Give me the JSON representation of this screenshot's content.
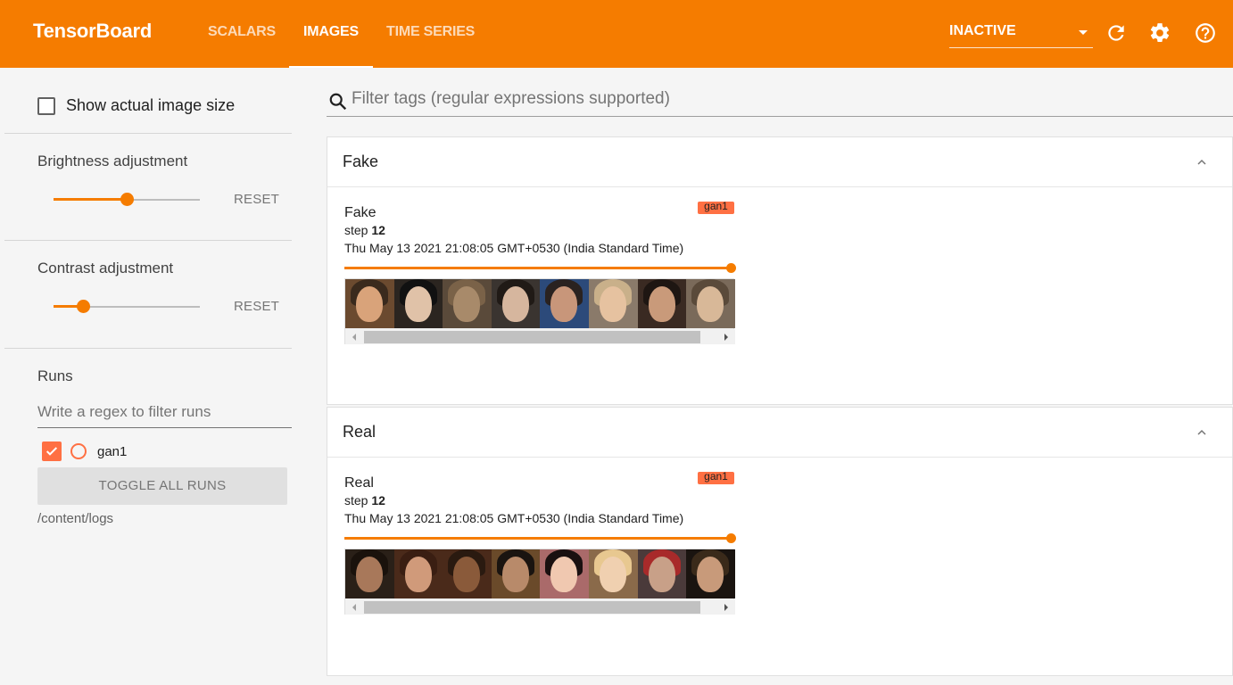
{
  "app": {
    "brand": "TensorBoard",
    "tabs": [
      {
        "label": "SCALARS",
        "active": false
      },
      {
        "label": "IMAGES",
        "active": true
      },
      {
        "label": "TIME SERIES",
        "active": false
      }
    ],
    "reload_status": "INACTIVE",
    "accent_color": "#f57c00",
    "run_color": "#ff7043"
  },
  "sidebar": {
    "show_actual_size_label": "Show actual image size",
    "show_actual_size_checked": false,
    "brightness": {
      "label": "Brightness adjustment",
      "reset_label": "RESET",
      "value_fraction": 0.5
    },
    "contrast": {
      "label": "Contrast adjustment",
      "reset_label": "RESET",
      "value_fraction": 0.2
    },
    "runs": {
      "title": "Runs",
      "filter_placeholder": "Write a regex to filter runs",
      "items": [
        {
          "name": "gan1",
          "checked": true
        }
      ],
      "toggle_all_label": "TOGGLE ALL RUNS",
      "logdir": "/content/logs"
    }
  },
  "main": {
    "filter_placeholder": "Filter tags (regular expressions supported)",
    "cards": [
      {
        "title": "Fake",
        "panel": {
          "tag": "Fake",
          "run": "gan1",
          "step_label": "step",
          "step": "12",
          "timestamp": "Thu May 13 2021 21:08:05 GMT+0530 (India Standard Time)"
        }
      },
      {
        "title": "Real",
        "panel": {
          "tag": "Real",
          "run": "gan1",
          "step_label": "step",
          "step": "12",
          "timestamp": "Thu May 13 2021 21:08:05 GMT+0530 (India Standard Time)"
        }
      }
    ]
  }
}
